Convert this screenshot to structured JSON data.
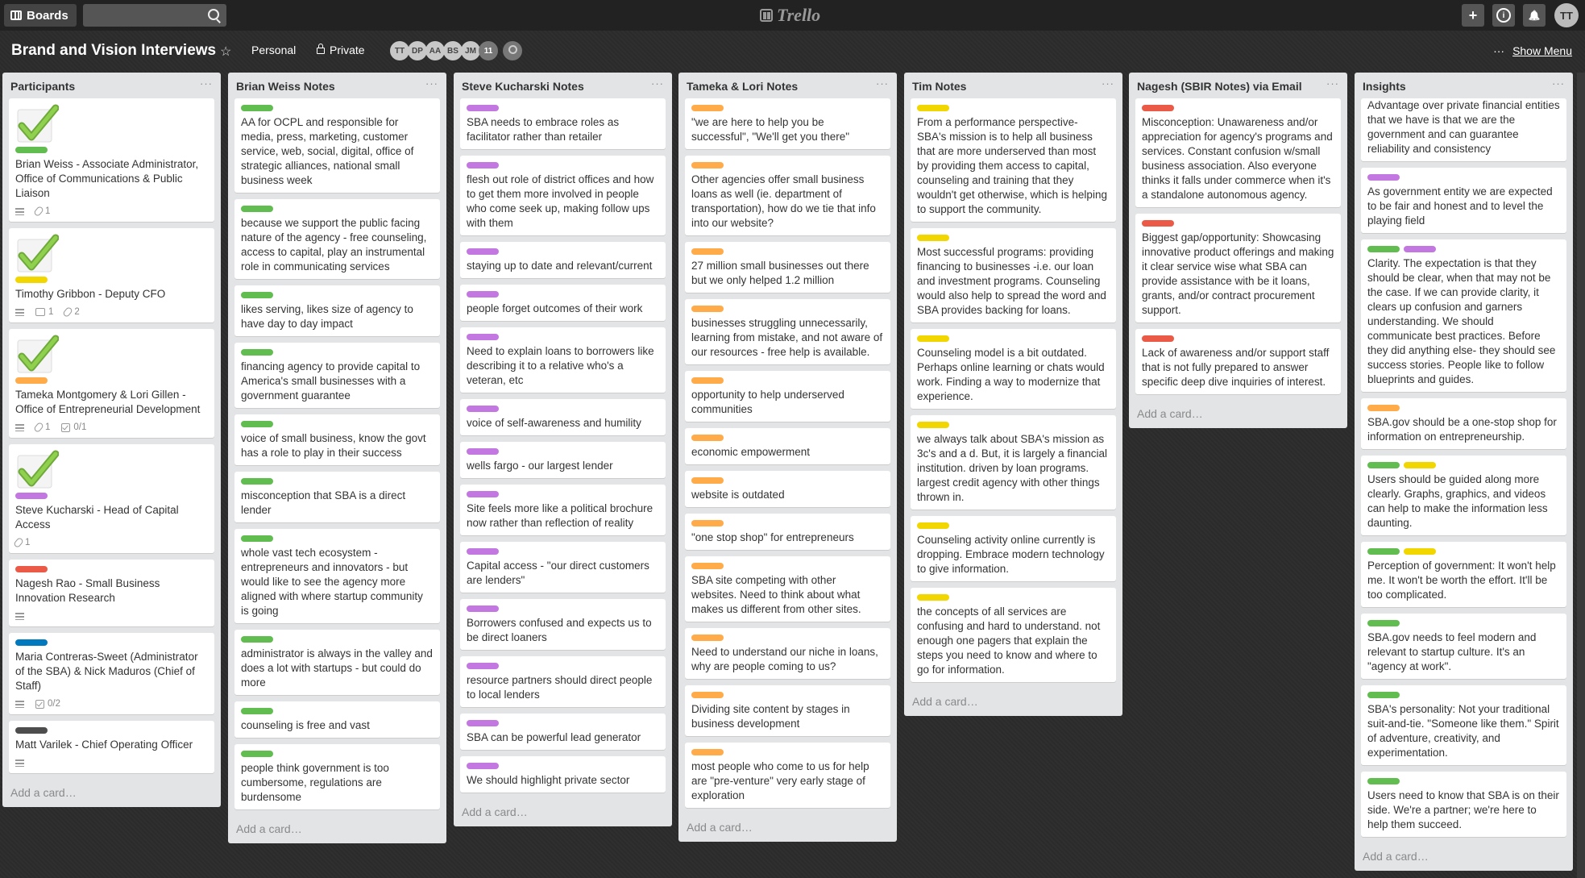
{
  "topbar": {
    "boards_label": "Boards",
    "logo_text": "Trello",
    "user_initials": "TT",
    "add_glyph": "+",
    "info_glyph": "i",
    "bell_glyph": "🔔"
  },
  "board": {
    "title": "Brand and Vision Interviews",
    "team": "Personal",
    "visibility": "Private",
    "members": [
      "TT",
      "DP",
      "AA",
      "BS",
      "JM",
      "11"
    ],
    "show_menu_dots": "···",
    "show_menu": "Show Menu"
  },
  "colors": {
    "green": "#61bd4f",
    "yellow": "#f2d600",
    "orange": "#ffab4a",
    "red": "#eb5a46",
    "purple": "#c377e0",
    "blue": "#0079bf",
    "black": "#4d4d4d"
  },
  "lists": [
    {
      "title": "Participants",
      "add_card": "Add a card…",
      "cards": [
        {
          "cover": "check",
          "labels": [
            "green"
          ],
          "text": "Brian Weiss - Associate Administrator, Office of Communications & Public Liaison",
          "badges": [
            {
              "icon": "desc"
            },
            {
              "icon": "clip",
              "text": "1"
            }
          ]
        },
        {
          "cover": "check",
          "labels": [
            "yellow"
          ],
          "text": "Timothy Gribbon - Deputy CFO",
          "badges": [
            {
              "icon": "desc"
            },
            {
              "icon": "comment",
              "text": "1"
            },
            {
              "icon": "clip",
              "text": "2"
            }
          ]
        },
        {
          "cover": "check",
          "labels": [
            "orange"
          ],
          "text": "Tameka Montgomery & Lori Gillen - Office of Entrepreneurial Development",
          "badges": [
            {
              "icon": "desc"
            },
            {
              "icon": "clip",
              "text": "1"
            },
            {
              "icon": "check",
              "text": "0/1"
            }
          ]
        },
        {
          "cover": "check",
          "labels": [
            "purple"
          ],
          "text": "Steve Kucharski - Head of Capital Access",
          "badges": [
            {
              "icon": "clip",
              "text": "1"
            }
          ]
        },
        {
          "labels": [
            "red"
          ],
          "text": "Nagesh Rao - Small Business Innovation Research",
          "badges": [
            {
              "icon": "desc"
            }
          ]
        },
        {
          "labels": [
            "blue"
          ],
          "text": "Maria Contreras-Sweet (Administrator of the SBA) & Nick Maduros (Chief of Staff)",
          "badges": [
            {
              "icon": "desc"
            },
            {
              "icon": "check",
              "text": "0/2"
            }
          ]
        },
        {
          "labels": [
            "black"
          ],
          "text": "Matt Varilek - Chief Operating Officer",
          "badges": [
            {
              "icon": "desc"
            }
          ]
        }
      ]
    },
    {
      "title": "Brian Weiss Notes",
      "add_card": "Add a card…",
      "cards": [
        {
          "labels": [
            "green"
          ],
          "text": "AA for OCPL and responsible for media, press, marketing, customer service, web, social, digital, office of strategic alliances, national small business week"
        },
        {
          "labels": [
            "green"
          ],
          "text": "because we support the public facing nature of the agency - free counseling, access to capital, play an instrumental role in communicating services"
        },
        {
          "labels": [
            "green"
          ],
          "text": "likes serving, likes size of agency to have day to day impact"
        },
        {
          "labels": [
            "green"
          ],
          "text": "financing agency to provide capital to America's small businesses with a government guarantee"
        },
        {
          "labels": [
            "green"
          ],
          "text": "voice of small business, know the govt has a role to play in their success"
        },
        {
          "labels": [
            "green"
          ],
          "text": "misconception that SBA is a direct lender"
        },
        {
          "labels": [
            "green"
          ],
          "text": "whole vast tech ecosystem - entrepreneurs and innovators - but would like to see the agency more aligned with where startup community is going"
        },
        {
          "labels": [
            "green"
          ],
          "text": "administrator is always in the valley and does a lot with startups - but could do more"
        },
        {
          "labels": [
            "green"
          ],
          "text": "counseling is free and vast"
        },
        {
          "labels": [
            "green"
          ],
          "text": "people think government is too cumbersome, regulations are burdensome"
        }
      ]
    },
    {
      "title": "Steve Kucharski Notes",
      "add_card": "Add a card…",
      "cards": [
        {
          "labels": [
            "purple"
          ],
          "text": "SBA needs to embrace roles as facilitator rather than retailer"
        },
        {
          "labels": [
            "purple"
          ],
          "text": "flesh out role of district offices and how to get them more involved in people who come seek up, making follow ups with them"
        },
        {
          "labels": [
            "purple"
          ],
          "text": "staying up to date and relevant/current"
        },
        {
          "labels": [
            "purple"
          ],
          "text": "people forget outcomes of their work"
        },
        {
          "labels": [
            "purple"
          ],
          "text": "Need to explain loans to borrowers like describing it to a relative who's a veteran, etc"
        },
        {
          "labels": [
            "purple"
          ],
          "text": "voice of self-awareness and humility"
        },
        {
          "labels": [
            "purple"
          ],
          "text": "wells fargo - our largest lender"
        },
        {
          "labels": [
            "purple"
          ],
          "text": "Site feels more like a political brochure now rather than reflection of reality"
        },
        {
          "labels": [
            "purple"
          ],
          "text": "Capital access - \"our direct customers are lenders\""
        },
        {
          "labels": [
            "purple"
          ],
          "text": "Borrowers confused and expects us to be direct loaners"
        },
        {
          "labels": [
            "purple"
          ],
          "text": "resource partners should direct people to local lenders"
        },
        {
          "labels": [
            "purple"
          ],
          "text": "SBA can be powerful lead generator"
        },
        {
          "labels": [
            "purple"
          ],
          "text": "We should highlight private sector"
        }
      ]
    },
    {
      "title": "Tameka & Lori Notes",
      "add_card": "Add a card…",
      "cards": [
        {
          "labels": [
            "orange"
          ],
          "text": "\"we are here to help you be successful\", \"We'll get you there\""
        },
        {
          "labels": [
            "orange"
          ],
          "text": "Other agencies offer small business loans as well (ie. department of transportation), how do we tie that info into our website?"
        },
        {
          "labels": [
            "orange"
          ],
          "text": "27 million small businesses out there but we only helped 1.2 million"
        },
        {
          "labels": [
            "orange"
          ],
          "text": "businesses struggling unnecessarily, learning from mistake, and not aware of our resources - free help is available."
        },
        {
          "labels": [
            "orange"
          ],
          "text": "opportunity to help underserved communities"
        },
        {
          "labels": [
            "orange"
          ],
          "text": "economic empowerment"
        },
        {
          "labels": [
            "orange"
          ],
          "text": "website is outdated"
        },
        {
          "labels": [
            "orange"
          ],
          "text": "\"one stop shop\" for entrepreneurs"
        },
        {
          "labels": [
            "orange"
          ],
          "text": "SBA site competing with other websites. Need to think about what makes us different from other sites."
        },
        {
          "labels": [
            "orange"
          ],
          "text": "Need to understand our niche in loans, why are people coming to us?"
        },
        {
          "labels": [
            "orange"
          ],
          "text": "Dividing site content by stages in business development"
        },
        {
          "labels": [
            "orange"
          ],
          "text": "most people who come to us for help are \"pre-venture\" very early stage of exploration"
        }
      ]
    },
    {
      "title": "Tim Notes",
      "add_card": "Add a card…",
      "cards": [
        {
          "labels": [
            "yellow"
          ],
          "text": "From a performance perspective- SBA's mission is to help all business that are more underserved than most by providing them access to capital, counseling and training that they wouldn't get otherwise, which is helping to support the community."
        },
        {
          "labels": [
            "yellow"
          ],
          "text": "Most successful programs: providing financing to businesses -i.e. our loan and investment programs. Counseling would also help to spread the word and SBA provides backing for loans."
        },
        {
          "labels": [
            "yellow"
          ],
          "text": "Counseling model is a bit outdated. Perhaps online learning or chats would work. Finding a way to modernize that experience."
        },
        {
          "labels": [
            "yellow"
          ],
          "text": "we always talk about SBA's mission as 3c's and a d. But, it is largely a financial institution. driven by loan programs. largest credit agency with other things thrown in."
        },
        {
          "labels": [
            "yellow"
          ],
          "text": "Counseling activity online currently is dropping. Embrace modern technology to give information."
        },
        {
          "labels": [
            "yellow"
          ],
          "text": "the concepts of all services are confusing and hard to understand. not enough one pagers that explain the steps you need to know and where to go for information."
        }
      ]
    },
    {
      "title": "Nagesh (SBIR Notes) via Email",
      "add_card": "Add a card…",
      "cards": [
        {
          "labels": [
            "red"
          ],
          "text": "Misconception: Unawareness and/or appreciation for agency's programs and services. Constant confusion w/small business association. Also everyone thinks it falls under commerce when it's a standalone autonomous agency."
        },
        {
          "labels": [
            "red"
          ],
          "text": "Biggest gap/opportunity: Showcasing innovative product offerings and making it clear service wise what SBA can provide assistance with be it loans, grants, and/or contract procurement support."
        },
        {
          "labels": [
            "red"
          ],
          "text": "Lack of awareness and/or support staff that is not fully prepared to answer specific deep dive inquiries of interest."
        }
      ]
    },
    {
      "title": "Insights",
      "add_card": "Add a card…",
      "cards": [
        {
          "labels": [],
          "text": "Advantage over private financial entities that we have is that we are the government and can guarantee reliability and consistency"
        },
        {
          "labels": [
            "purple"
          ],
          "text": "As government entity we are expected to be fair and honest and to level the playing field"
        },
        {
          "labels": [
            "green",
            "purple"
          ],
          "text": "Clarity. The expectation is that they should be clear, when that may not be the case. If we can provide clarity, it clears up confusion and garners understanding. We should communicate best practices. Before they did anything else- they should see success stories. People like to follow blueprints and guides."
        },
        {
          "labels": [
            "orange"
          ],
          "text": "SBA.gov should be a one-stop shop for information on entrepreneurship."
        },
        {
          "labels": [
            "green",
            "yellow"
          ],
          "text": "Users should be guided along more clearly. Graphs, graphics, and videos can help to make the information less daunting."
        },
        {
          "labels": [
            "green",
            "yellow"
          ],
          "text": "Perception of government: It won't help me. It won't be worth the effort. It'll be too complicated."
        },
        {
          "labels": [
            "green"
          ],
          "text": "SBA.gov needs to feel modern and relevant to startup culture. It's an \"agency at work\"."
        },
        {
          "labels": [
            "green"
          ],
          "text": "SBA's personality: Not your traditional suit-and-tie. \"Someone like them.\" Spirit of adventure, creativity, and experimentation."
        },
        {
          "labels": [
            "green"
          ],
          "text": "Users need to know that SBA is on their side. We're a partner; we're here to help them succeed."
        }
      ]
    }
  ]
}
